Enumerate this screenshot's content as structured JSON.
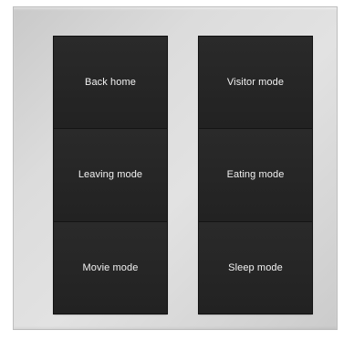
{
  "panel": {
    "left_column": [
      {
        "label": "Back home"
      },
      {
        "label": "Leaving mode"
      },
      {
        "label": "Movie mode"
      }
    ],
    "right_column": [
      {
        "label": "Visitor mode"
      },
      {
        "label": "Eating mode"
      },
      {
        "label": "Sleep mode"
      }
    ]
  },
  "colors": {
    "plate": "#dcdcdc",
    "key": "#252525",
    "text": "#f2f2f2"
  }
}
